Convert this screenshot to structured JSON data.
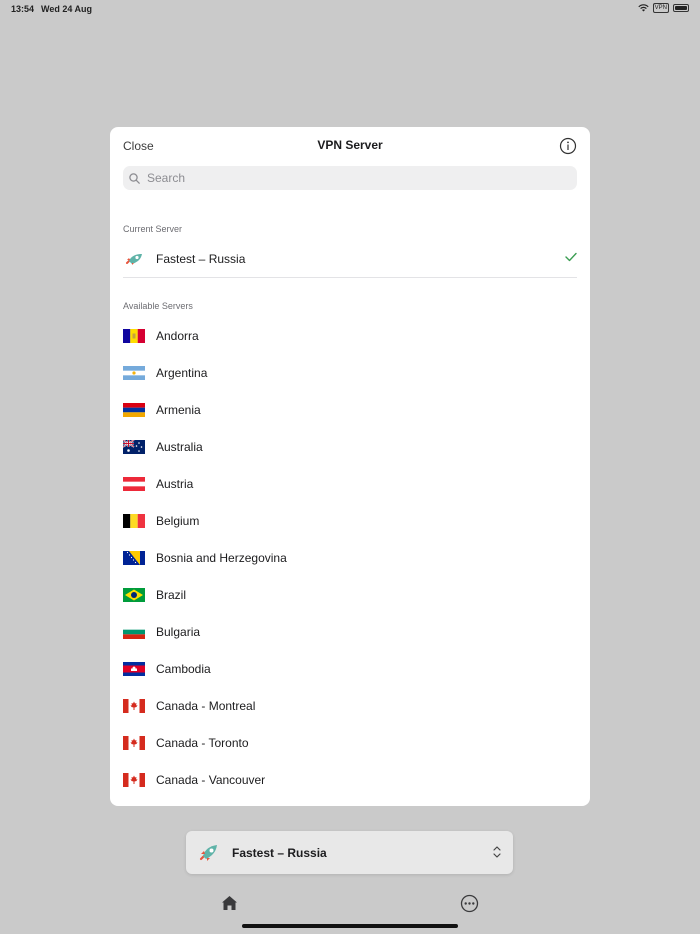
{
  "status_bar": {
    "time": "13:54",
    "date": "Wed 24 Aug",
    "vpn_badge": "VPN"
  },
  "modal": {
    "close_label": "Close",
    "title": "VPN Server",
    "search_placeholder": "Search",
    "current_section_label": "Current Server",
    "current_server": {
      "name": "Fastest – Russia",
      "icon": "rocket-icon",
      "selected": true
    },
    "available_section_label": "Available Servers",
    "servers": [
      {
        "name": "Andorra",
        "flag": "andorra"
      },
      {
        "name": "Argentina",
        "flag": "argentina"
      },
      {
        "name": "Armenia",
        "flag": "armenia"
      },
      {
        "name": "Australia",
        "flag": "australia"
      },
      {
        "name": "Austria",
        "flag": "austria"
      },
      {
        "name": "Belgium",
        "flag": "belgium"
      },
      {
        "name": "Bosnia and Herzegovina",
        "flag": "bosnia"
      },
      {
        "name": "Brazil",
        "flag": "brazil"
      },
      {
        "name": "Bulgaria",
        "flag": "bulgaria"
      },
      {
        "name": "Cambodia",
        "flag": "cambodia"
      },
      {
        "name": "Canada - Montreal",
        "flag": "canada"
      },
      {
        "name": "Canada - Toronto",
        "flag": "canada"
      },
      {
        "name": "Canada - Vancouver",
        "flag": "canada"
      }
    ]
  },
  "bottom_bar": {
    "server_name": "Fastest – Russia",
    "icon": "rocket-icon"
  },
  "tab_bar": {
    "items": [
      {
        "icon": "home-icon"
      },
      {
        "icon": "more-icon"
      }
    ]
  },
  "colors": {
    "accent_check": "#3b9d52",
    "backdrop": "#cacaca"
  }
}
